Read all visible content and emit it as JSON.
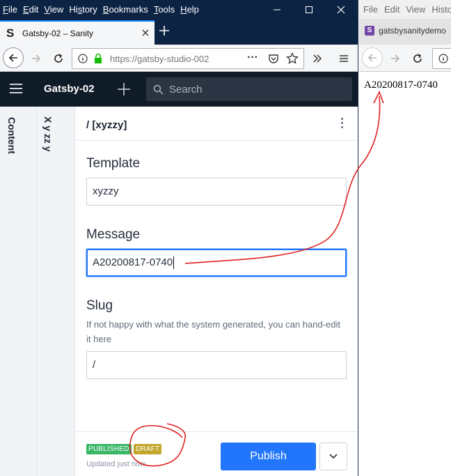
{
  "left_window": {
    "menu": [
      "File",
      "Edit",
      "View",
      "History",
      "Bookmarks",
      "Tools",
      "Help"
    ],
    "menu_mnemonics": [
      "F",
      "E",
      "V",
      "s",
      "B",
      "T",
      "H"
    ],
    "tab_title": "Gatsby-02 – Sanity",
    "tab_favicon": "S",
    "url": "https://gatsby-studio-002",
    "url_more": "···"
  },
  "sanity": {
    "project": "Gatsby-02",
    "search_placeholder": "Search",
    "pane_content_title": "Content",
    "pane_list_title": "X y zz y",
    "document_title": "/ [xyzzy]",
    "fields": {
      "template": {
        "label": "Template",
        "value": "xyzzy"
      },
      "message": {
        "label": "Message",
        "value": "A20200817-0740"
      },
      "slug": {
        "label": "Slug",
        "description": "If not happy with what the system generated, you can hand-edit it here",
        "value": "/"
      }
    },
    "footer": {
      "badge_published": "PUBLISHED",
      "badge_draft": "DRAFT",
      "updated": "Updated just now",
      "publish_label": "Publish"
    },
    "colors": {
      "accent": "#2276fc",
      "published": "#3ab667",
      "draft": "#c3a72d",
      "topbar": "#101b28"
    }
  },
  "right_window": {
    "menu": [
      "File",
      "Edit",
      "View",
      "Histo"
    ],
    "tab_title": "gatsbysanitydemo",
    "tab_favicon": "S",
    "page_text": "A20200817-0740"
  },
  "annotation_color": "#e02020"
}
